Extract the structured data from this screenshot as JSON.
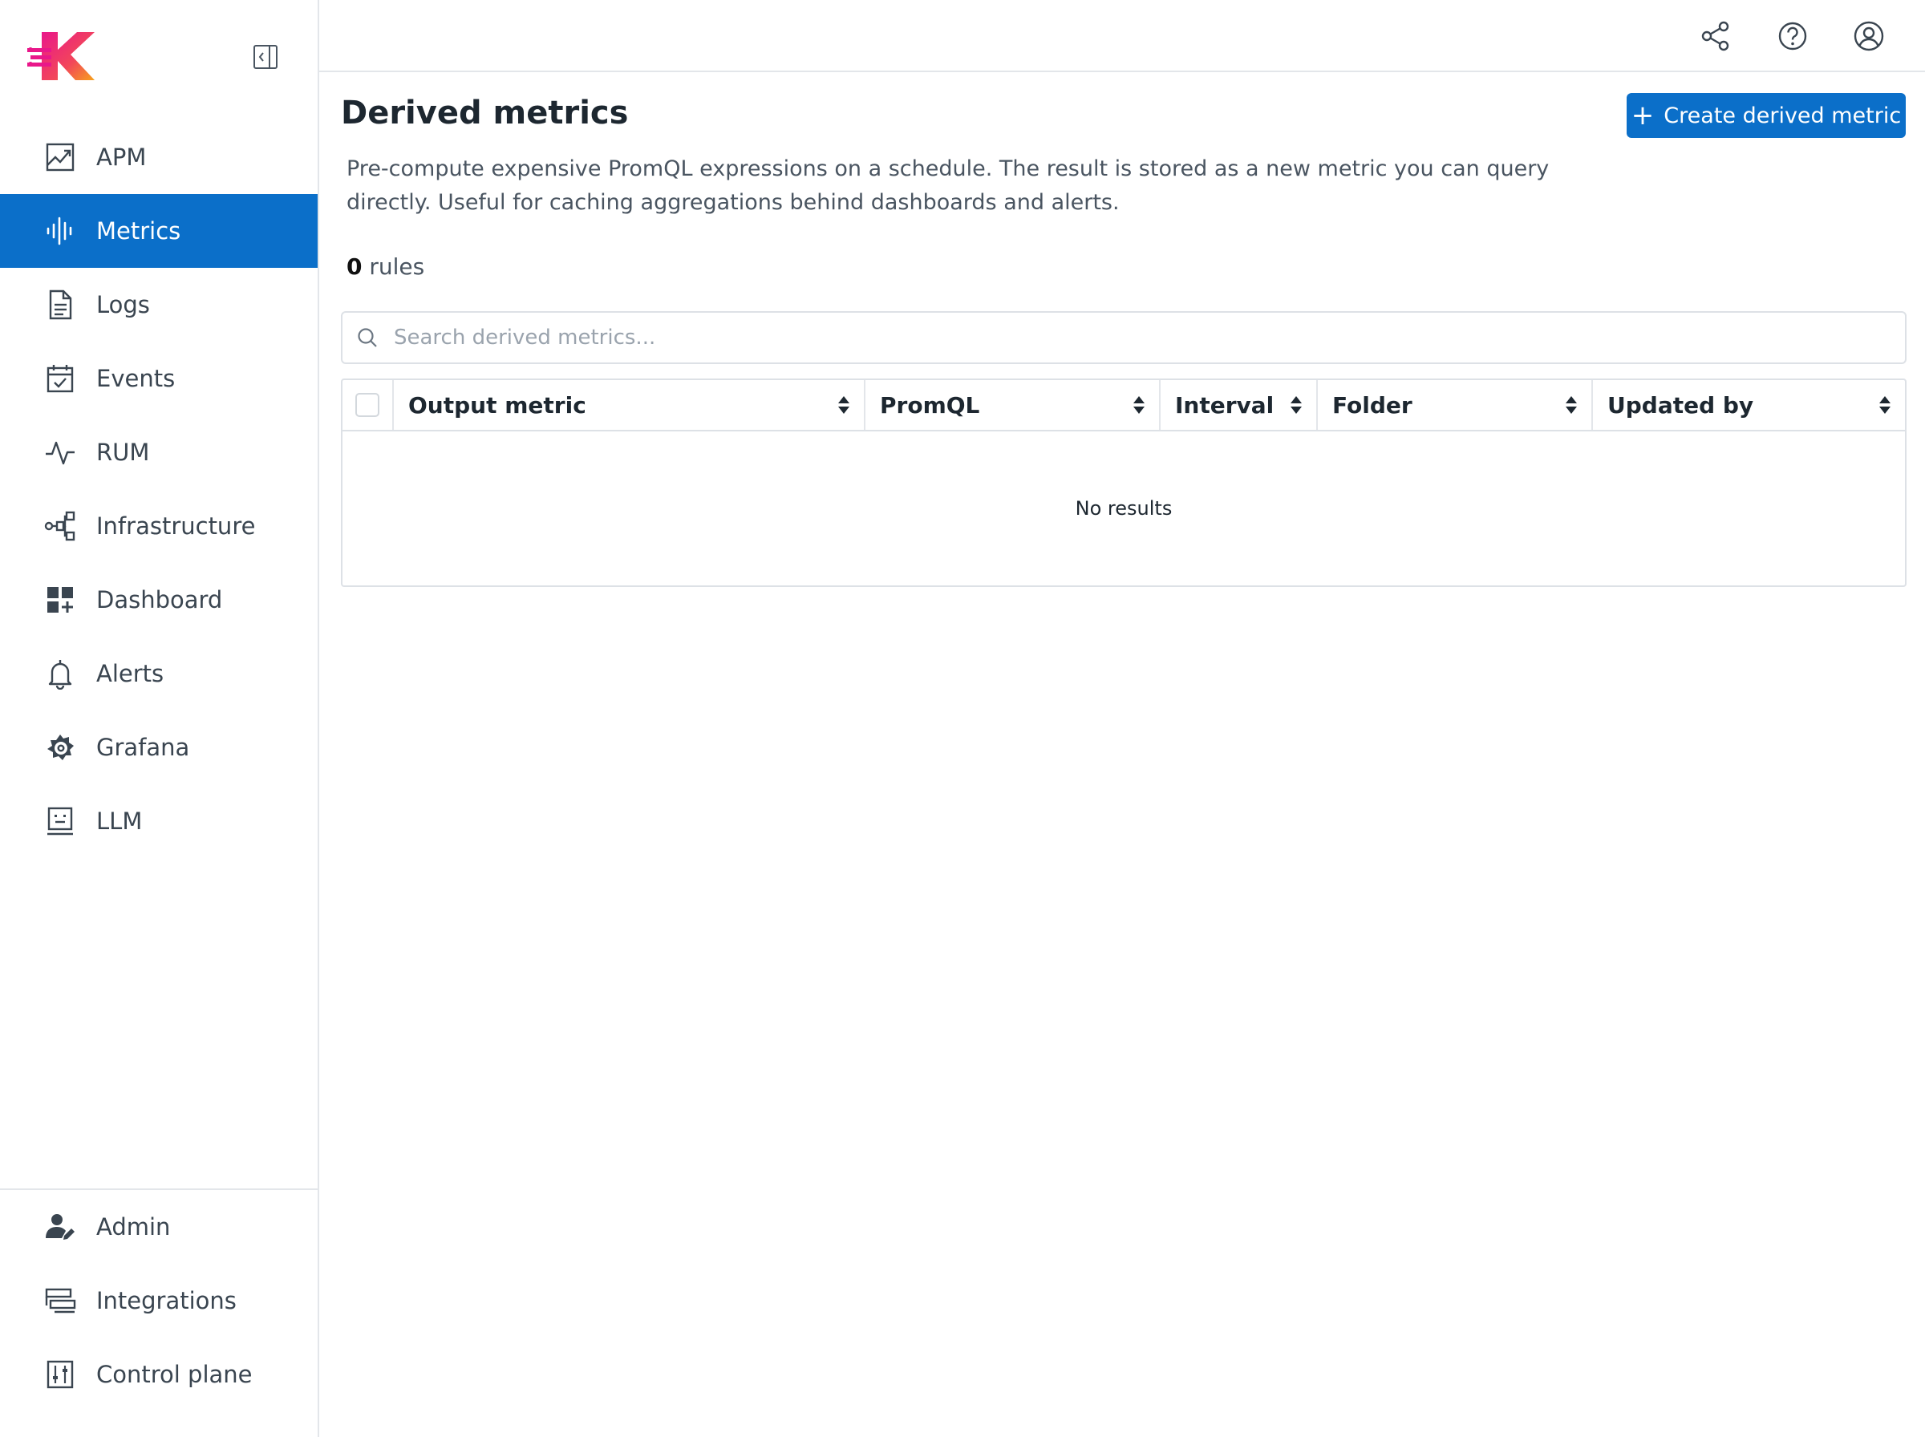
{
  "sidebar": {
    "logo_letter": "K",
    "items": [
      {
        "label": "APM",
        "icon": "apm-chart-icon"
      },
      {
        "label": "Metrics",
        "icon": "waveform-icon",
        "active": true
      },
      {
        "label": "Logs",
        "icon": "document-icon"
      },
      {
        "label": "Events",
        "icon": "calendar-check-icon"
      },
      {
        "label": "RUM",
        "icon": "pulse-icon"
      },
      {
        "label": "Infrastructure",
        "icon": "network-nodes-icon"
      },
      {
        "label": "Dashboard",
        "icon": "dashboard-grid-icon"
      },
      {
        "label": "Alerts",
        "icon": "bell-icon"
      },
      {
        "label": "Grafana",
        "icon": "grafana-icon"
      },
      {
        "label": "LLM",
        "icon": "robot-face-icon"
      }
    ],
    "bottom_items": [
      {
        "label": "Admin",
        "icon": "user-edit-icon"
      },
      {
        "label": "Integrations",
        "icon": "integrations-icon"
      },
      {
        "label": "Control plane",
        "icon": "sliders-icon"
      }
    ]
  },
  "header": {
    "icons": [
      "share-icon",
      "help-icon",
      "user-account-icon"
    ]
  },
  "page": {
    "title": "Derived metrics",
    "create_button": "Create derived metric",
    "description": "Pre-compute expensive PromQL expressions on a schedule. The result is stored as a new metric you can query directly. Useful for caching aggregations behind dashboards and alerts.",
    "rules_count": "0",
    "rules_label": "rules"
  },
  "search": {
    "placeholder": "Search derived metrics..."
  },
  "table": {
    "columns": [
      "Output metric",
      "PromQL",
      "Interval",
      "Folder",
      "Updated by"
    ],
    "empty_text": "No results"
  },
  "colors": {
    "accent": "#0b6fc9",
    "border": "#dde1e6",
    "text": "#1d2730",
    "muted": "#4a5561"
  }
}
